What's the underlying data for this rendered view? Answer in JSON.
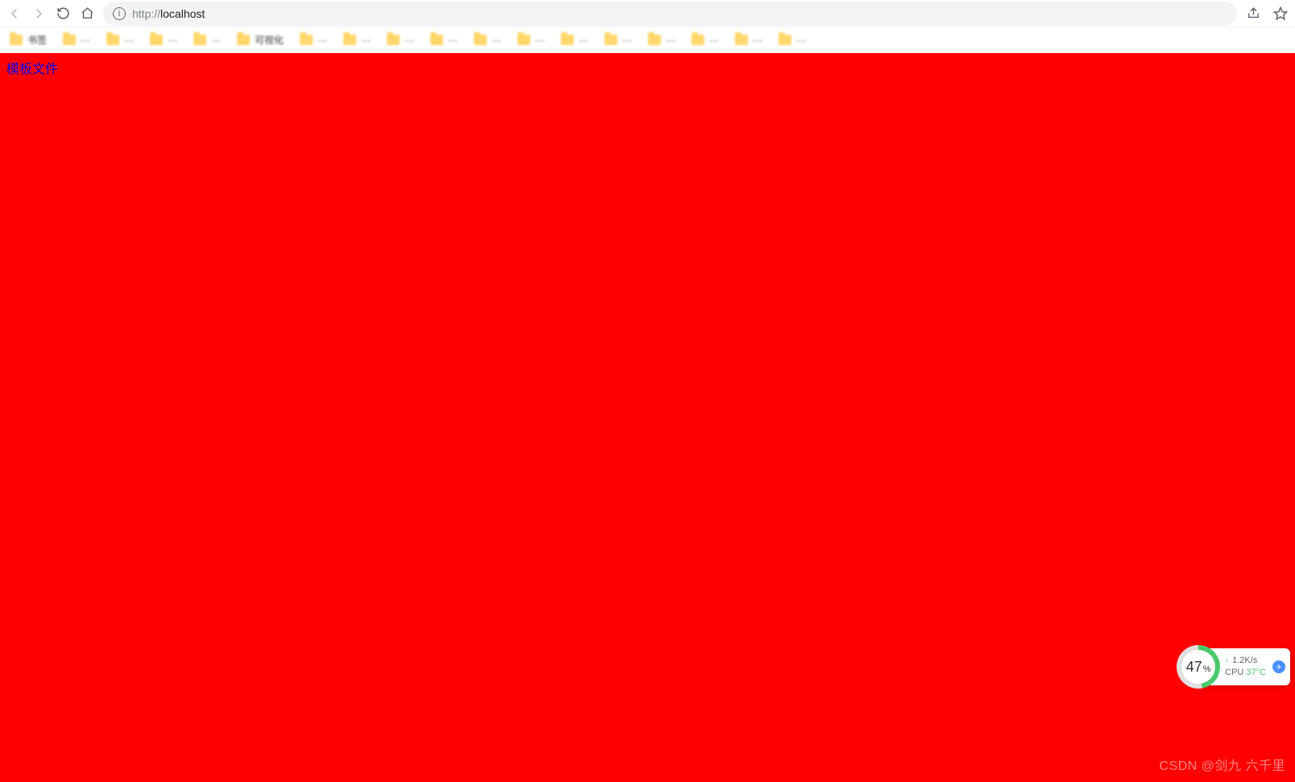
{
  "toolbar": {
    "url_scheme": "http://",
    "url_host": "localhost"
  },
  "bookmarks": [
    {
      "label": "书签"
    },
    {
      "label": "···"
    },
    {
      "label": "···"
    },
    {
      "label": "···"
    },
    {
      "label": "···"
    },
    {
      "label": "可视化"
    },
    {
      "label": "···"
    },
    {
      "label": "···"
    },
    {
      "label": "···"
    },
    {
      "label": "···"
    },
    {
      "label": "···"
    },
    {
      "label": "···"
    },
    {
      "label": "···"
    },
    {
      "label": "···"
    },
    {
      "label": "···"
    },
    {
      "label": "···"
    },
    {
      "label": "···"
    },
    {
      "label": "···"
    }
  ],
  "page": {
    "link_text": "模板文件"
  },
  "sysmon": {
    "percent_value": "47",
    "percent_symbol": "%",
    "net_speed": "1.2K/s",
    "cpu_label": "CPU",
    "cpu_temp": "37°C"
  },
  "watermark": "CSDN @剑九 六千里"
}
